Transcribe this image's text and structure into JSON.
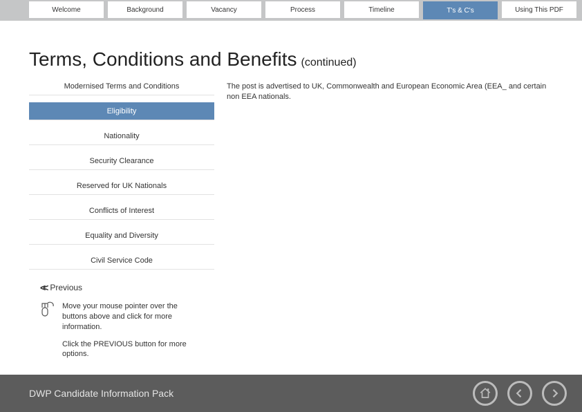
{
  "tabs": {
    "welcome": "Welcome",
    "background": "Background",
    "vacancy": "Vacancy",
    "process": "Process",
    "timeline": "Timeline",
    "tcs": "T's & C's",
    "using": "Using This PDF"
  },
  "heading": {
    "main": "Terms, Conditions and Benefits",
    "sub": "(continued)"
  },
  "side": {
    "modernised": "Modernised Terms and Conditions",
    "eligibility": "Eligibility",
    "nationality": "Nationality",
    "security": "Security Clearance",
    "reserved": "Reserved for UK Nationals",
    "conflicts": "Conflicts of Interest",
    "equality": "Equality and Diversity",
    "civil": "Civil Service Code"
  },
  "body": "The post is advertised to UK, Commonwealth and European Economic Area (EEA_ and certain non EEA nationals.",
  "prev": "Previous",
  "hint": {
    "p1": "Move your mouse pointer over the buttons above and click for more information.",
    "p2": "Click the PREVIOUS button for more options."
  },
  "footer": "DWP Candidate Information Pack"
}
